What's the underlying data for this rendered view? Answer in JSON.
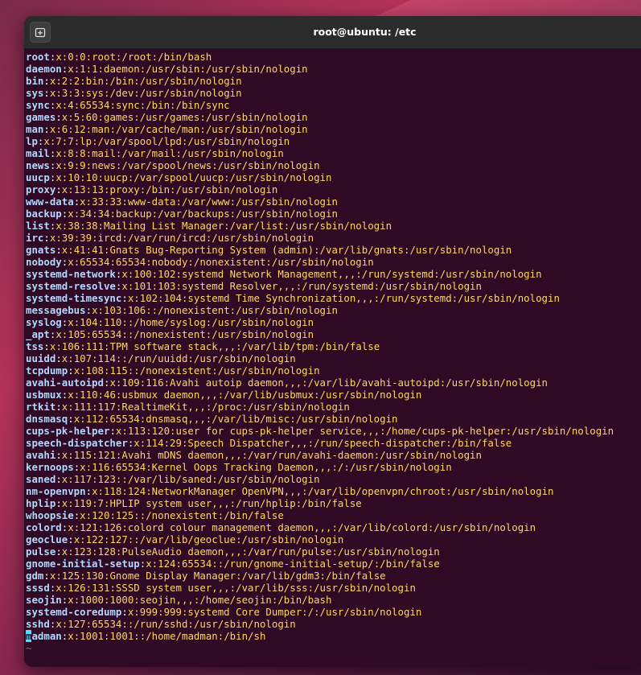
{
  "window": {
    "title": "root@ubuntu: /etc"
  },
  "icons": {
    "new_tab": "new-tab-icon"
  },
  "terminal": {
    "lines": [
      {
        "user": "root",
        "rest": "x:0:0:root:/root:/bin/bash"
      },
      {
        "user": "daemon",
        "rest": "x:1:1:daemon:/usr/sbin:/usr/sbin/nologin"
      },
      {
        "user": "bin",
        "rest": "x:2:2:bin:/bin:/usr/sbin/nologin"
      },
      {
        "user": "sys",
        "rest": "x:3:3:sys:/dev:/usr/sbin/nologin"
      },
      {
        "user": "sync",
        "rest": "x:4:65534:sync:/bin:/bin/sync"
      },
      {
        "user": "games",
        "rest": "x:5:60:games:/usr/games:/usr/sbin/nologin"
      },
      {
        "user": "man",
        "rest": "x:6:12:man:/var/cache/man:/usr/sbin/nologin"
      },
      {
        "user": "lp",
        "rest": "x:7:7:lp:/var/spool/lpd:/usr/sbin/nologin"
      },
      {
        "user": "mail",
        "rest": "x:8:8:mail:/var/mail:/usr/sbin/nologin"
      },
      {
        "user": "news",
        "rest": "x:9:9:news:/var/spool/news:/usr/sbin/nologin"
      },
      {
        "user": "uucp",
        "rest": "x:10:10:uucp:/var/spool/uucp:/usr/sbin/nologin"
      },
      {
        "user": "proxy",
        "rest": "x:13:13:proxy:/bin:/usr/sbin/nologin"
      },
      {
        "user": "www-data",
        "rest": "x:33:33:www-data:/var/www:/usr/sbin/nologin"
      },
      {
        "user": "backup",
        "rest": "x:34:34:backup:/var/backups:/usr/sbin/nologin"
      },
      {
        "user": "list",
        "rest": "x:38:38:Mailing List Manager:/var/list:/usr/sbin/nologin"
      },
      {
        "user": "irc",
        "rest": "x:39:39:ircd:/var/run/ircd:/usr/sbin/nologin"
      },
      {
        "user": "gnats",
        "rest": "x:41:41:Gnats Bug-Reporting System (admin):/var/lib/gnats:/usr/sbin/nologin"
      },
      {
        "user": "nobody",
        "rest": "x:65534:65534:nobody:/nonexistent:/usr/sbin/nologin"
      },
      {
        "user": "systemd-network",
        "rest": "x:100:102:systemd Network Management,,,:/run/systemd:/usr/sbin/nologin"
      },
      {
        "user": "systemd-resolve",
        "rest": "x:101:103:systemd Resolver,,,:/run/systemd:/usr/sbin/nologin"
      },
      {
        "user": "systemd-timesync",
        "rest": "x:102:104:systemd Time Synchronization,,,:/run/systemd:/usr/sbin/nologin"
      },
      {
        "user": "messagebus",
        "rest": "x:103:106::/nonexistent:/usr/sbin/nologin"
      },
      {
        "user": "syslog",
        "rest": "x:104:110::/home/syslog:/usr/sbin/nologin"
      },
      {
        "user": "_apt",
        "rest": "x:105:65534::/nonexistent:/usr/sbin/nologin"
      },
      {
        "user": "tss",
        "rest": "x:106:111:TPM software stack,,,:/var/lib/tpm:/bin/false"
      },
      {
        "user": "uuidd",
        "rest": "x:107:114::/run/uuidd:/usr/sbin/nologin"
      },
      {
        "user": "tcpdump",
        "rest": "x:108:115::/nonexistent:/usr/sbin/nologin"
      },
      {
        "user": "avahi-autoipd",
        "rest": "x:109:116:Avahi autoip daemon,,,:/var/lib/avahi-autoipd:/usr/sbin/nologin"
      },
      {
        "user": "usbmux",
        "rest": "x:110:46:usbmux daemon,,,:/var/lib/usbmux:/usr/sbin/nologin"
      },
      {
        "user": "rtkit",
        "rest": "x:111:117:RealtimeKit,,,:/proc:/usr/sbin/nologin"
      },
      {
        "user": "dnsmasq",
        "rest": "x:112:65534:dnsmasq,,,:/var/lib/misc:/usr/sbin/nologin"
      },
      {
        "user": "cups-pk-helper",
        "rest": "x:113:120:user for cups-pk-helper service,,,:/home/cups-pk-helper:/usr/sbin/nologin"
      },
      {
        "user": "speech-dispatcher",
        "rest": "x:114:29:Speech Dispatcher,,,:/run/speech-dispatcher:/bin/false"
      },
      {
        "user": "avahi",
        "rest": "x:115:121:Avahi mDNS daemon,,,:/var/run/avahi-daemon:/usr/sbin/nologin"
      },
      {
        "user": "kernoops",
        "rest": "x:116:65534:Kernel Oops Tracking Daemon,,,:/:/usr/sbin/nologin"
      },
      {
        "user": "saned",
        "rest": "x:117:123::/var/lib/saned:/usr/sbin/nologin"
      },
      {
        "user": "nm-openvpn",
        "rest": "x:118:124:NetworkManager OpenVPN,,,:/var/lib/openvpn/chroot:/usr/sbin/nologin"
      },
      {
        "user": "hplip",
        "rest": "x:119:7:HPLIP system user,,,:/run/hplip:/bin/false"
      },
      {
        "user": "whoopsie",
        "rest": "x:120:125::/nonexistent:/bin/false"
      },
      {
        "user": "colord",
        "rest": "x:121:126:colord colour management daemon,,,:/var/lib/colord:/usr/sbin/nologin"
      },
      {
        "user": "geoclue",
        "rest": "x:122:127::/var/lib/geoclue:/usr/sbin/nologin"
      },
      {
        "user": "pulse",
        "rest": "x:123:128:PulseAudio daemon,,,:/var/run/pulse:/usr/sbin/nologin"
      },
      {
        "user": "gnome-initial-setup",
        "rest": "x:124:65534::/run/gnome-initial-setup/:/bin/false"
      },
      {
        "user": "gdm",
        "rest": "x:125:130:Gnome Display Manager:/var/lib/gdm3:/bin/false"
      },
      {
        "user": "sssd",
        "rest": "x:126:131:SSSD system user,,,:/var/lib/sss:/usr/sbin/nologin"
      },
      {
        "user": "seojin",
        "rest": "x:1000:1000:seojin,,,:/home/seojin:/bin/bash"
      },
      {
        "user": "systemd-coredump",
        "rest": "x:999:999:systemd Core Dumper:/:/usr/sbin/nologin"
      },
      {
        "user": "sshd",
        "rest": "x:127:65534::/run/sshd:/usr/sbin/nologin"
      }
    ],
    "last_line": {
      "cursor_char": "m",
      "user_rest": "adman",
      "rest": "x:1001:1001::/home/madman:/bin/sh"
    },
    "empty_line_marker": "~"
  },
  "colors": {
    "background": "#300a24",
    "titlebar": "#2b2b2b",
    "username": "#b3d8ff",
    "fields": "#ffd75f",
    "cursor": "#5fd7ff"
  }
}
